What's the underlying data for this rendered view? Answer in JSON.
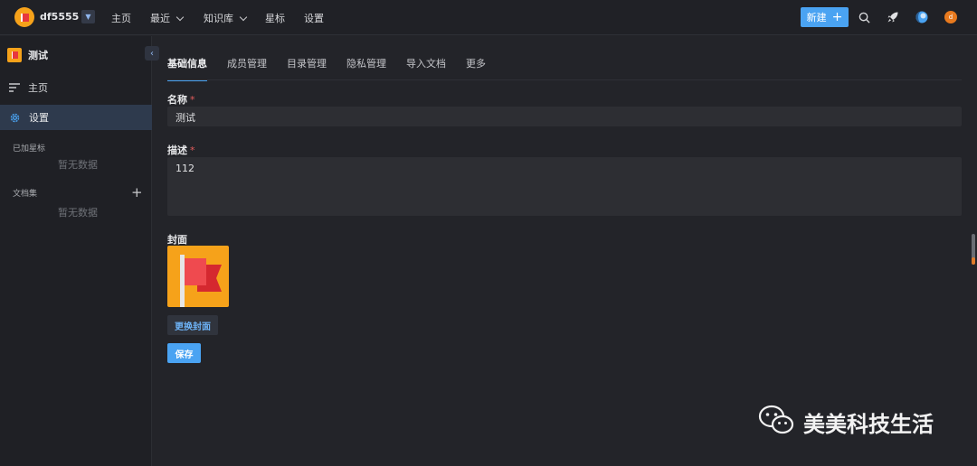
{
  "topbar": {
    "workspace_name": "df5555",
    "nav": [
      {
        "label": "主页"
      },
      {
        "label": "最近"
      },
      {
        "label": "知识库"
      },
      {
        "label": "星标"
      },
      {
        "label": "设置"
      }
    ],
    "new_label": "新建",
    "avatar_letter": "d"
  },
  "sidebar": {
    "book_title": "测试",
    "items": [
      {
        "label": "主页"
      },
      {
        "label": "设置"
      }
    ],
    "sections": [
      {
        "title": "已加星标",
        "empty": "暂无数据"
      },
      {
        "title": "文档集",
        "empty": "暂无数据"
      }
    ]
  },
  "tabs": [
    {
      "label": "基础信息"
    },
    {
      "label": "成员管理"
    },
    {
      "label": "目录管理"
    },
    {
      "label": "隐私管理"
    },
    {
      "label": "导入文档"
    },
    {
      "label": "更多"
    }
  ],
  "form": {
    "name_label": "名称",
    "required_mark": "*",
    "name_value": "测试",
    "desc_label": "描述",
    "desc_value": "112",
    "cover_label": "封面",
    "change_cover_label": "更换封面",
    "save_label": "保存"
  },
  "watermark": {
    "text": "美美科技生活"
  },
  "colors": {
    "accent": "#4aa3f2",
    "cover_bg": "#f6a21a",
    "flag_red": "#e8383d"
  }
}
